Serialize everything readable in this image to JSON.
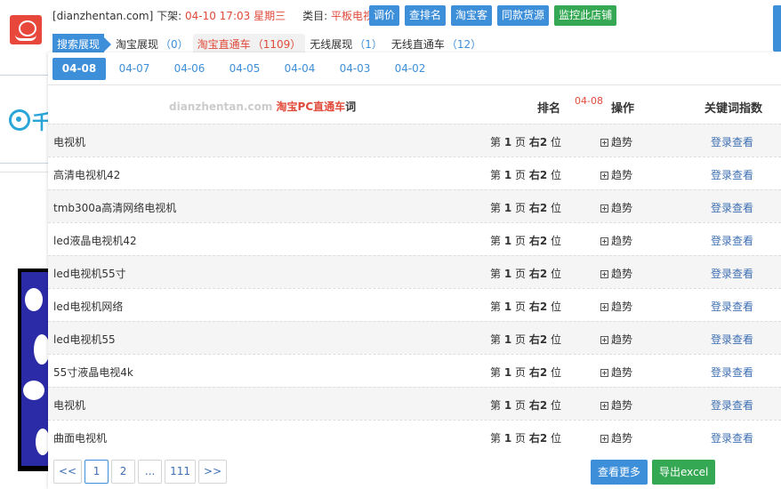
{
  "header": {
    "site": "[dianzhentan.com]",
    "offshelf_label": "下架:",
    "offshelf_value": "04-10 17:03 星期三",
    "category_label": "类目:",
    "category_value": "平板电视",
    "buttons": [
      "调价",
      "查排名",
      "淘宝客",
      "同款货源",
      "监控此店铺"
    ]
  },
  "tabs": [
    {
      "label": "搜索展现",
      "count": ""
    },
    {
      "label": "淘宝展现",
      "count": "（0）"
    },
    {
      "label": "淘宝直通车",
      "count": "（1109）"
    },
    {
      "label": "无线展现",
      "count": "（1）"
    },
    {
      "label": "无线直通车",
      "count": "（12）"
    }
  ],
  "dates": [
    "04-08",
    "04-07",
    "04-06",
    "04-05",
    "04-04",
    "04-03",
    "04-02"
  ],
  "table": {
    "brand_site": "dianzhentan.com",
    "brand_title": "淘宝PC直通车",
    "brand_suffix": "词",
    "col_rank": "排名",
    "col_date": "04-08",
    "col_action": "操作",
    "col_index": "关键词指数",
    "rows": [
      {
        "keyword": "电视机",
        "page": "1",
        "pos": "右2",
        "trend": "趋势",
        "link": "登录查看"
      },
      {
        "keyword": "高清电视机42",
        "page": "1",
        "pos": "右2",
        "trend": "趋势",
        "link": "登录查看"
      },
      {
        "keyword": "tmb300a高清网络电视机",
        "page": "1",
        "pos": "右2",
        "trend": "趋势",
        "link": "登录查看"
      },
      {
        "keyword": "led液晶电视机42",
        "page": "1",
        "pos": "右2",
        "trend": "趋势",
        "link": "登录查看"
      },
      {
        "keyword": "led电视机55寸",
        "page": "1",
        "pos": "右2",
        "trend": "趋势",
        "link": "登录查看"
      },
      {
        "keyword": "led电视机网络",
        "page": "1",
        "pos": "右2",
        "trend": "趋势",
        "link": "登录查看"
      },
      {
        "keyword": "led电视机55",
        "page": "1",
        "pos": "右2",
        "trend": "趋势",
        "link": "登录查看"
      },
      {
        "keyword": "55寸液晶电视4k",
        "page": "1",
        "pos": "右2",
        "trend": "趋势",
        "link": "登录查看"
      },
      {
        "keyword": "电视机",
        "page": "1",
        "pos": "右2",
        "trend": "趋势",
        "link": "登录查看"
      },
      {
        "keyword": "曲面电视机",
        "page": "1",
        "pos": "右2",
        "trend": "趋势",
        "link": "登录查看"
      }
    ]
  },
  "pager": [
    "<<",
    "1",
    "2",
    "...",
    "111",
    ">>"
  ],
  "footer": {
    "more": "查看更多",
    "export": "导出excel"
  },
  "background": {
    "logo_text": "千"
  },
  "colors": {
    "accent": "#3e8fd9",
    "red": "#e04a3a",
    "green": "#34a853"
  }
}
